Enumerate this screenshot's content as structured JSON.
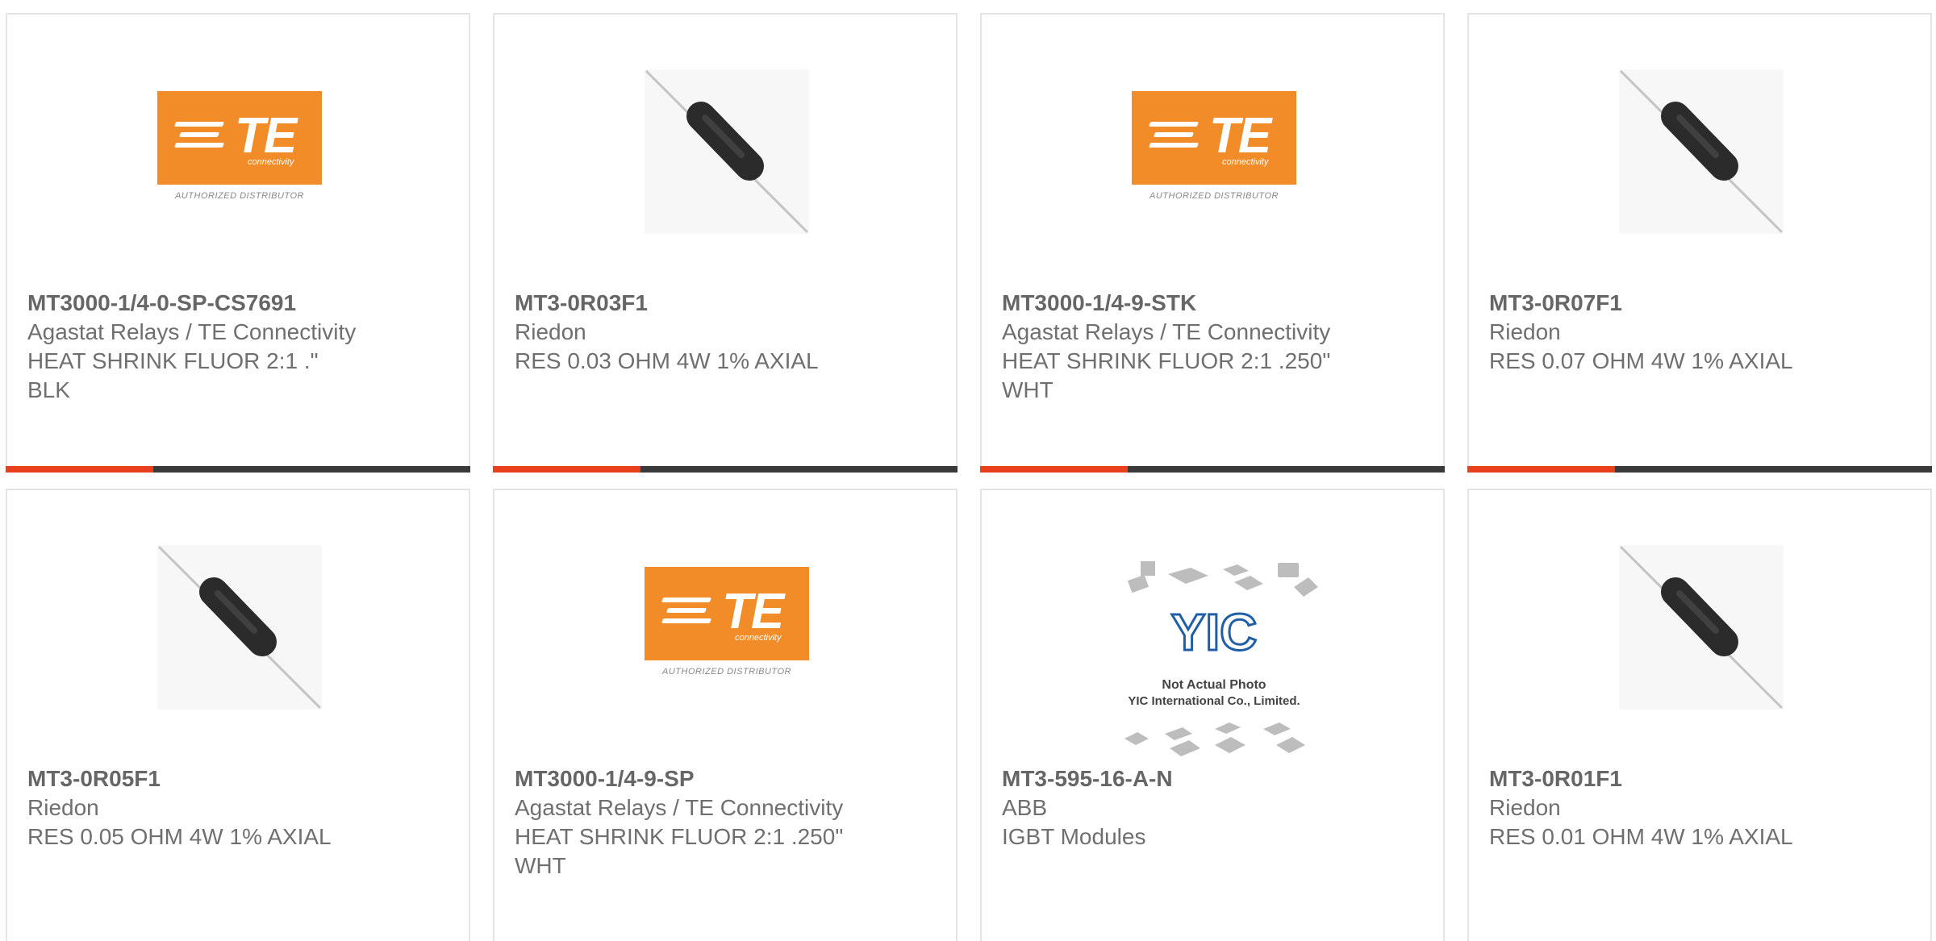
{
  "products": [
    {
      "part": "MT3000-1/4-0-SP-CS7691",
      "manufacturer": "Agastat Relays / TE Connectivity",
      "description": "HEAT SHRINK FLUOR 2:1 .\"\nBLK",
      "image": "te-logo"
    },
    {
      "part": "MT3-0R03F1",
      "manufacturer": "Riedon",
      "description": "RES 0.03 OHM 4W 1% AXIAL",
      "image": "resistor"
    },
    {
      "part": "MT3000-1/4-9-STK",
      "manufacturer": "Agastat Relays / TE Connectivity",
      "description": "HEAT SHRINK FLUOR 2:1 .250\"\nWHT",
      "image": "te-logo"
    },
    {
      "part": "MT3-0R07F1",
      "manufacturer": "Riedon",
      "description": "RES 0.07 OHM 4W 1% AXIAL",
      "image": "resistor"
    },
    {
      "part": "MT3-0R05F1",
      "manufacturer": "Riedon",
      "description": "RES 0.05 OHM 4W 1% AXIAL",
      "image": "resistor"
    },
    {
      "part": "MT3000-1/4-9-SP",
      "manufacturer": "Agastat Relays / TE Connectivity",
      "description": "HEAT SHRINK FLUOR 2:1 .250\"\nWHT",
      "image": "te-logo"
    },
    {
      "part": "MT3-595-16-A-N",
      "manufacturer": "ABB",
      "description": "IGBT Modules",
      "image": "yic-placeholder"
    },
    {
      "part": "MT3-0R01F1",
      "manufacturer": "Riedon",
      "description": "RES 0.01 OHM 4W 1% AXIAL",
      "image": "resistor"
    }
  ],
  "te_logo": {
    "text": "TE",
    "sub": "connectivity",
    "authorized": "AUTHORIZED DISTRIBUTOR"
  },
  "yic": {
    "logo": "YIC",
    "line1": "Not Actual Photo",
    "line2": "YIC International Co., Limited."
  },
  "colors": {
    "accent": "#e8401c",
    "bar": "#3a3a3a",
    "te_orange": "#f28c28"
  }
}
